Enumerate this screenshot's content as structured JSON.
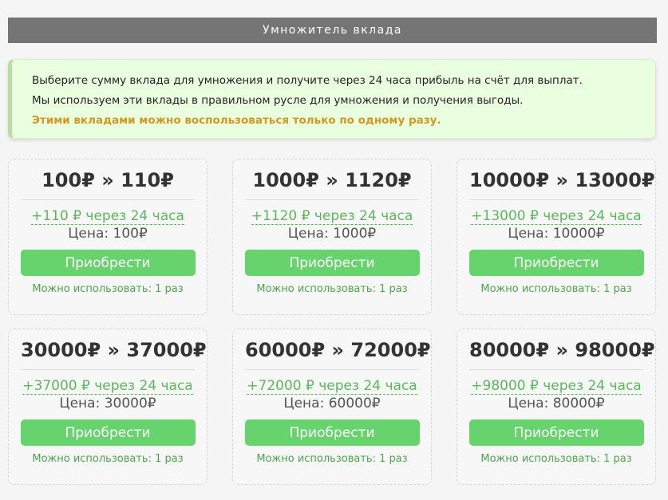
{
  "header": {
    "title": "Умножитель вклада"
  },
  "notice": {
    "line1": "Выберите сумму вклада для умножения и получите через 24 часа прибыль на счёт для выплат.",
    "line2": "Мы используем эти вклады в правильном русле для умножения и получения выгоды.",
    "warning": "Этими вкладами можно воспользоваться только по одному разу."
  },
  "cards": [
    {
      "title": "100₽ » 110₽",
      "profit": "+110 ₽ через 24 часа",
      "price": "Цена: 100₽",
      "button": "Приобрести",
      "uses": "Можно использовать: 1 раз"
    },
    {
      "title": "1000₽ » 1120₽",
      "profit": "+1120 ₽ через 24 часа",
      "price": "Цена: 1000₽",
      "button": "Приобрести",
      "uses": "Можно использовать: 1 раз"
    },
    {
      "title": "10000₽ » 13000₽",
      "profit": "+13000 ₽ через 24 часа",
      "price": "Цена: 10000₽",
      "button": "Приобрести",
      "uses": "Можно использовать: 1 раз"
    },
    {
      "title": "30000₽ » 37000₽",
      "profit": "+37000 ₽ через 24 часа",
      "price": "Цена: 30000₽",
      "button": "Приобрести",
      "uses": "Можно использовать: 1 раз"
    },
    {
      "title": "60000₽ » 72000₽",
      "profit": "+72000 ₽ через 24 часа",
      "price": "Цена: 60000₽",
      "button": "Приобрести",
      "uses": "Можно использовать: 1 раз"
    },
    {
      "title": "80000₽ » 98000₽",
      "profit": "+98000 ₽ через 24 часа",
      "price": "Цена: 80000₽",
      "button": "Приобрести",
      "uses": "Можно использовать: 1 раз"
    }
  ]
}
